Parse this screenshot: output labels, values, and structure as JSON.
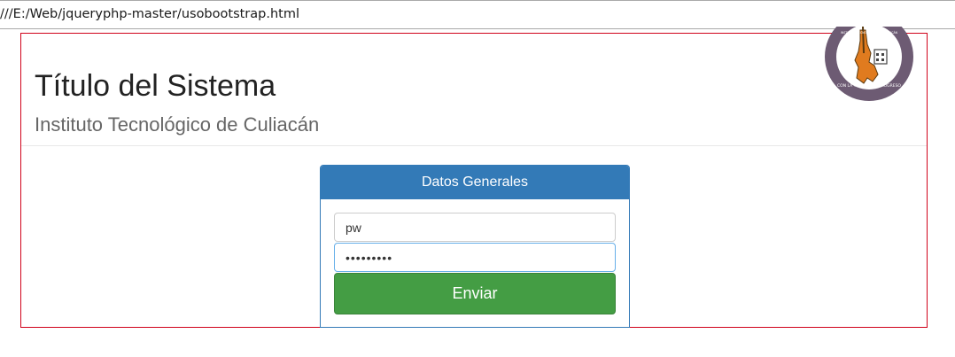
{
  "browser": {
    "url": "///E:/Web/jqueryphp-master/usobootstrap.html"
  },
  "header": {
    "title": "Título del Sistema",
    "subtitle": "Instituto Tecnológico de Culiacán",
    "logo": {
      "text_top": "INSTITUTO TECNOLÓGICO DE CULIACÁN",
      "text_bottom": "CON LA TÉCNICA AL PROGRESO",
      "ring_color": "#6d5b73",
      "figure_color": "#e07b1f"
    }
  },
  "panel": {
    "heading": "Datos Generales",
    "username_value": "pw",
    "password_value": "•••••••••",
    "submit_label": "Enviar",
    "heading_color": "#337ab7",
    "button_color": "#449d44"
  }
}
